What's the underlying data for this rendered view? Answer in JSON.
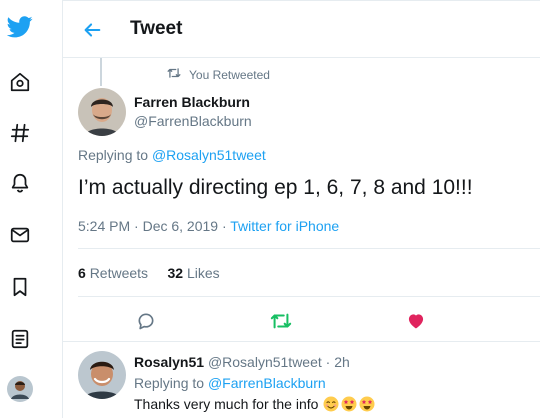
{
  "sidebar": {
    "icons": [
      "twitter-logo-icon",
      "home-icon",
      "explore-hashtag-icon",
      "notifications-bell-icon",
      "messages-mail-icon",
      "bookmark-icon",
      "lists-icon",
      "profile-avatar-icon"
    ]
  },
  "header": {
    "title": "Tweet"
  },
  "retweet": {
    "label": "You Retweeted"
  },
  "tweet": {
    "author_name": "Farren Blackburn",
    "author_handle": "@FarrenBlackburn",
    "replying_prefix": "Replying to",
    "replying_to": "@Rosalyn51tweet",
    "text": "I’m actually directing ep 1, 6, 7, 8 and 10!!!",
    "timestamp": "5:24 PM · Dec 6, 2019 · ",
    "source": "Twitter for iPhone",
    "retweets_count": "6",
    "retweets_label": "Retweets",
    "likes_count": "32",
    "likes_label": "Likes",
    "liked": true
  },
  "reply": {
    "author_name": "Rosalyn51",
    "handle_time": "@Rosalyn51tweet · 2h",
    "replying_prefix": "Replying to",
    "replying_to": "@FarrenBlackburn",
    "text": "Thanks very much for the info",
    "emojis": [
      "smiling-face-icon",
      "star-struck-icon",
      "star-struck-icon"
    ]
  },
  "colors": {
    "brand": "#1da1f2",
    "like": "#e0245e",
    "retweet": "#17bf63",
    "text": "#14171a",
    "muted": "#657786",
    "border": "#e6ecf0"
  }
}
